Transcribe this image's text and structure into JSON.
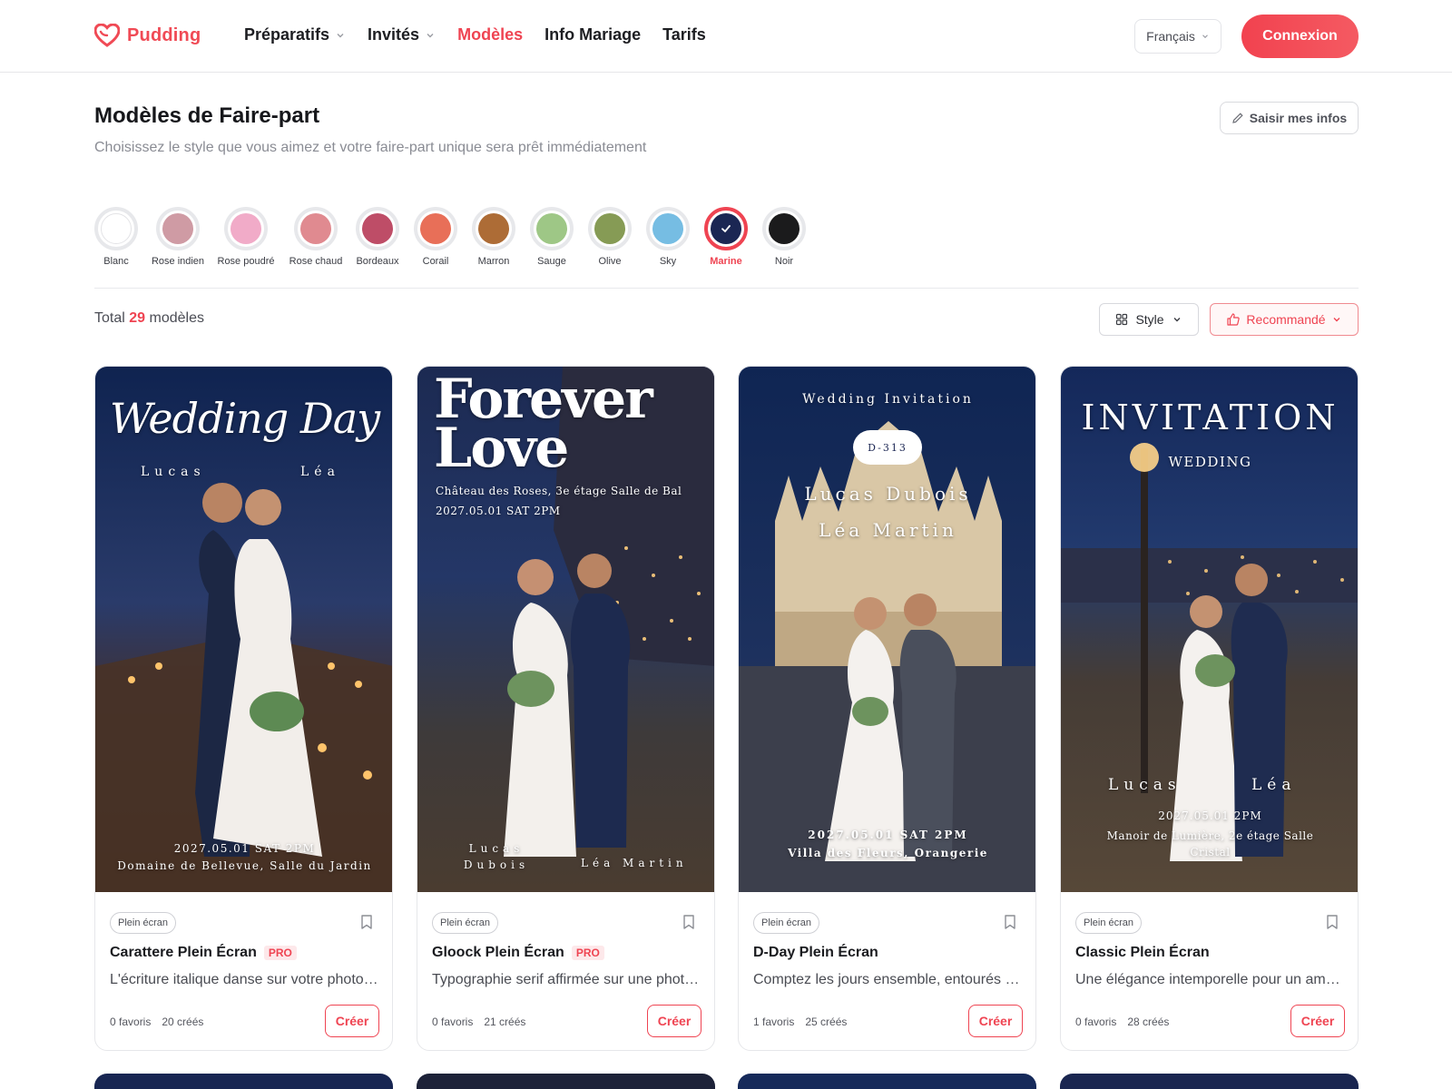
{
  "brand": {
    "name": "Pudding",
    "accent": "#ef4452"
  },
  "nav": {
    "items": [
      {
        "label": "Préparatifs",
        "dropdown": true,
        "active": false
      },
      {
        "label": "Invités",
        "dropdown": true,
        "active": false
      },
      {
        "label": "Modèles",
        "dropdown": false,
        "active": true
      },
      {
        "label": "Info Mariage",
        "dropdown": false,
        "active": false
      },
      {
        "label": "Tarifs",
        "dropdown": false,
        "active": false
      }
    ],
    "language": "Français",
    "login": "Connexion"
  },
  "page": {
    "title": "Modèles de Faire-part",
    "subtitle": "Choisissez le style que vous aimez et votre faire-part unique sera prêt immédiatement",
    "edit_button": "Saisir mes infos"
  },
  "colors": [
    {
      "label": "Blanc",
      "hex": "#ffffff",
      "selected": false
    },
    {
      "label": "Rose indien",
      "hex": "#cf9ba4",
      "selected": false
    },
    {
      "label": "Rose poudré",
      "hex": "#f1abc8",
      "selected": false
    },
    {
      "label": "Rose chaud",
      "hex": "#e08a90",
      "selected": false
    },
    {
      "label": "Bordeaux",
      "hex": "#be4d67",
      "selected": false
    },
    {
      "label": "Corail",
      "hex": "#e86f58",
      "selected": false
    },
    {
      "label": "Marron",
      "hex": "#ad6c36",
      "selected": false
    },
    {
      "label": "Sauge",
      "hex": "#9ec786",
      "selected": false
    },
    {
      "label": "Olive",
      "hex": "#869b55",
      "selected": false
    },
    {
      "label": "Sky",
      "hex": "#76bde3",
      "selected": false
    },
    {
      "label": "Marine",
      "hex": "#1b2653",
      "selected": true
    },
    {
      "label": "Noir",
      "hex": "#1b1b1c",
      "selected": false
    }
  ],
  "listing": {
    "total_prefix": "Total",
    "total_count": "29",
    "total_suffix": "modèles",
    "style_filter": "Style",
    "sort": "Recommandé"
  },
  "cards": [
    {
      "tag": "Plein écran",
      "title": "Carattere Plein Écran",
      "pro": "PRO",
      "description": "L'écriture italique danse sur votre photo d...",
      "favorites": "0 favoris",
      "created": "20 créés",
      "create": "Créer",
      "overlay": {
        "headline": "Wedding Day",
        "groom": "Lucas",
        "bride": "Léa",
        "date": "2027.05.01 SAT 2PM",
        "venue": "Domaine de Bellevue, Salle du Jardin"
      }
    },
    {
      "tag": "Plein écran",
      "title": "Gloock Plein Écran",
      "pro": "PRO",
      "description": "Typographie serif affirmée sur une photo ...",
      "favorites": "0 favoris",
      "created": "21 créés",
      "create": "Créer",
      "overlay": {
        "headline_1": "Forever",
        "headline_2": "Love",
        "venue": "Château des Roses, 3e étage Salle de Bal",
        "date": "2027.05.01 SAT 2PM",
        "groom": "Lucas Dubois",
        "bride": "Léa Martin"
      }
    },
    {
      "tag": "Plein écran",
      "title": "D-Day Plein Écran",
      "pro": "",
      "description": "Comptez les jours ensemble, entourés de ...",
      "favorites": "1 favoris",
      "created": "25 créés",
      "create": "Créer",
      "overlay": {
        "headline": "Wedding Invitation",
        "dday": "D-313",
        "groom": "Lucas Dubois",
        "bride": "Léa Martin",
        "date": "2027.05.01 SAT 2PM",
        "venue": "Villa des Fleurs, Orangerie"
      }
    },
    {
      "tag": "Plein écran",
      "title": "Classic Plein Écran",
      "pro": "",
      "description": "Une élégance intemporelle pour un amour...",
      "favorites": "0 favoris",
      "created": "28 créés",
      "create": "Créer",
      "overlay": {
        "headline": "INVITATION",
        "subhead": "WEDDING",
        "groom": "Lucas",
        "bride": "Léa",
        "date": "2027.05.01 2PM",
        "venue": "Manoir de Lumière, 2e étage Salle Cristal"
      }
    }
  ]
}
